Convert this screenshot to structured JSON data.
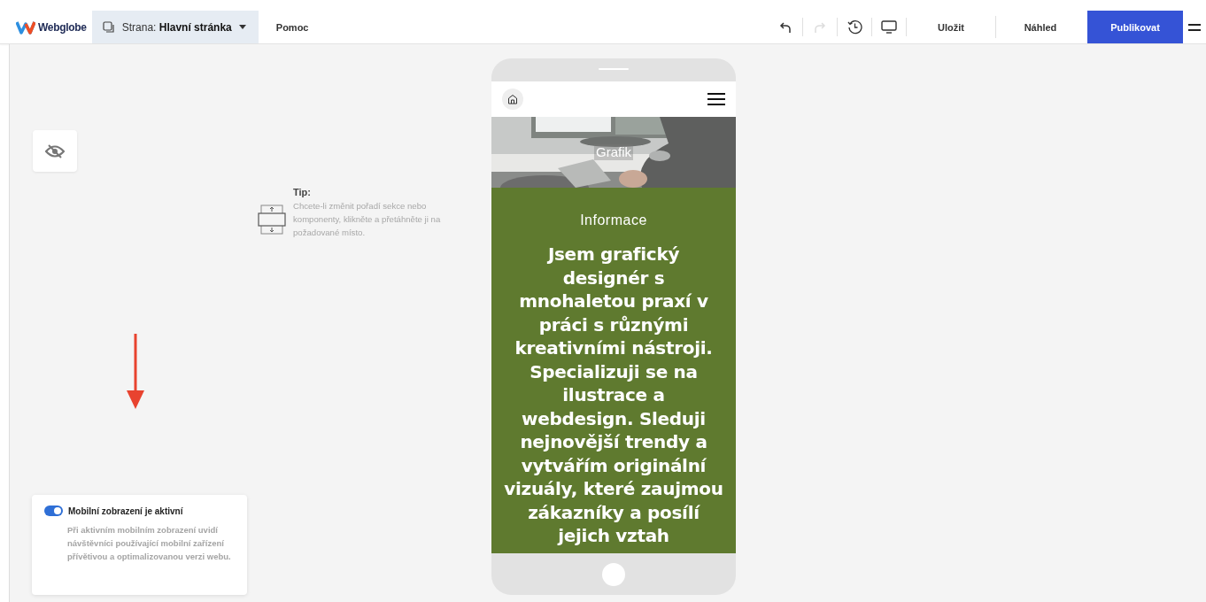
{
  "toolbar": {
    "brand": "Webglobe",
    "page_selector": "Strana: **Hlavní stránka**",
    "help": "Pomoc",
    "undo_disabled": false,
    "redo_disabled": true,
    "buttons": [
      {
        "label": "Uložit",
        "kind": "plain"
      },
      {
        "label": "Náhled",
        "kind": "plain"
      },
      {
        "label": "Publikovat",
        "kind": "primary"
      }
    ]
  },
  "tip": {
    "title": "Tip:",
    "text": "Chcete-li změnit pořadí sekce nebo komponenty, klikněte a přetáhněte ji na požadované místo."
  },
  "phone": {
    "hero": {
      "kind": "picture",
      "caption": "Grafik"
    },
    "section": {
      "heading": "Informace",
      "text": "Jsem grafický designér s mnohaletou praxí v práci s různými kreativními nástroji. Specializuji se na ilustrace a webdesign. Sleduji nejnovější trendy a vytvářím originální vizuály, které zaujmou zákazníky a posílí jejich vztah"
    }
  },
  "mobile_notice": {
    "on": true,
    "title": "Mobilní zobrazení je aktivní",
    "text": "Při aktivním mobilním zobrazení uvidí návštěvníci používající mobilní zařízení přívětivou a optimalizovanou verzi webu."
  }
}
